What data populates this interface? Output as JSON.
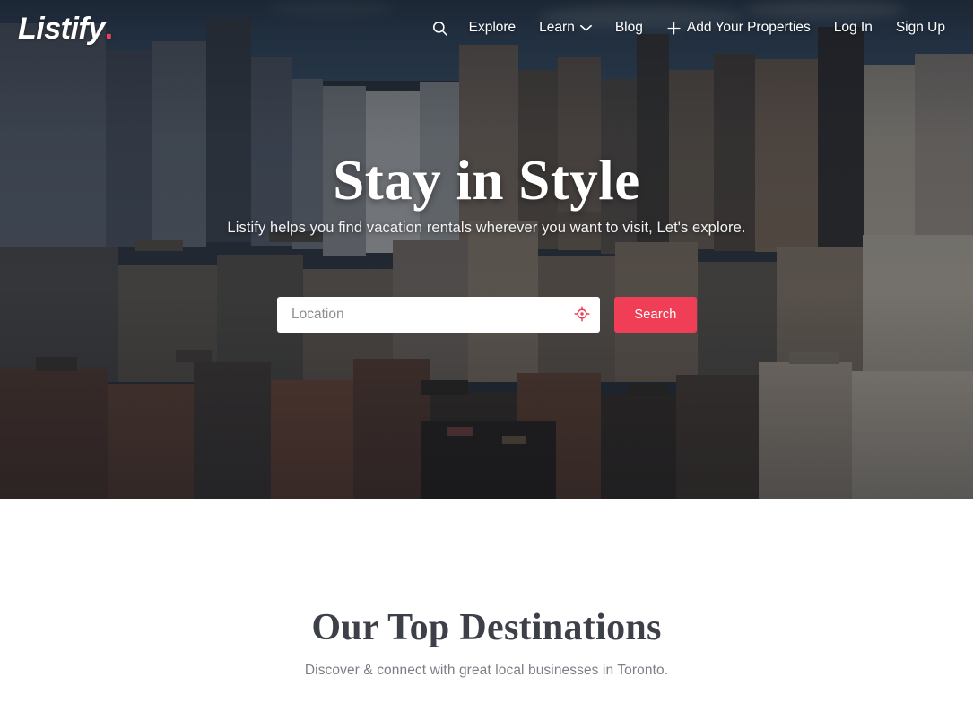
{
  "brand": {
    "name": "Listify",
    "dot": ".",
    "accent_color": "#ef3e55"
  },
  "nav": {
    "search_icon": "search-icon",
    "items": [
      {
        "label": "Explore",
        "icon": null
      },
      {
        "label": "Learn",
        "icon": "chevron-down-icon"
      },
      {
        "label": "Blog",
        "icon": null
      },
      {
        "label": "Add Your Properties",
        "icon": "plus-icon"
      },
      {
        "label": "Log In",
        "icon": null
      },
      {
        "label": "Sign Up",
        "icon": null
      }
    ]
  },
  "hero": {
    "title": "Stay in Style",
    "subtitle": "Listify helps you find vacation rentals wherever you want to visit, Let's explore.",
    "search": {
      "placeholder": "Location",
      "value": "",
      "locate_icon": "geolocate-crosshair-icon",
      "button_label": "Search"
    }
  },
  "destinations": {
    "title": "Our Top Destinations",
    "subtitle": "Discover & connect with great local businesses in Toronto."
  }
}
